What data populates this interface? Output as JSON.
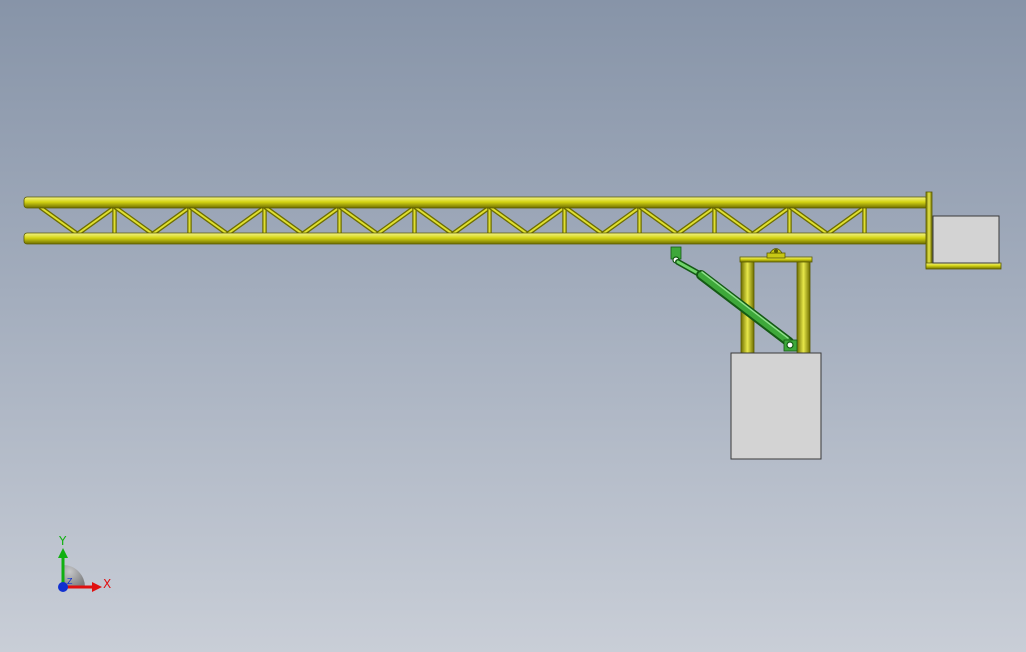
{
  "colors": {
    "truss": "#d4d414",
    "truss_dark": "#6e6e00",
    "truss_light": "#f4f48a",
    "cylinder": "#3ea83a",
    "cylinder_dark": "#145a14",
    "block": "#d3d3d3",
    "block_edge": "#3a3a3a",
    "axis_x": "#e01010",
    "axis_y": "#10b010",
    "axis_z": "#1030d0"
  },
  "triad": {
    "x_label": "X",
    "y_label": "Y",
    "z_label": "Z"
  },
  "icons": [
    "view-orientation-triad-icon"
  ]
}
